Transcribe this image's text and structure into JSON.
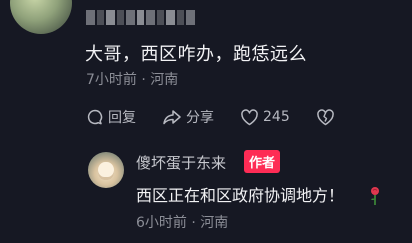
{
  "comment": {
    "text": "大哥，西区咋办，跑恁远么",
    "time": "7小时前",
    "separator": "·",
    "location": "河南"
  },
  "actions": {
    "reply_label": "回复",
    "share_label": "分享",
    "like_count": "245"
  },
  "reply": {
    "username": "傻坏蛋于东来",
    "author_tag": "作者",
    "text": "西区正在和区政府协调地方！",
    "time": "6小时前",
    "separator": "·",
    "location": "河南"
  },
  "colors": {
    "background": "#161823",
    "author_tag": "#fe2c55",
    "meta_text": "#8b8d96"
  },
  "icons": [
    "reply-icon",
    "share-icon",
    "heart-icon",
    "broken-heart-icon",
    "rose-icon"
  ]
}
